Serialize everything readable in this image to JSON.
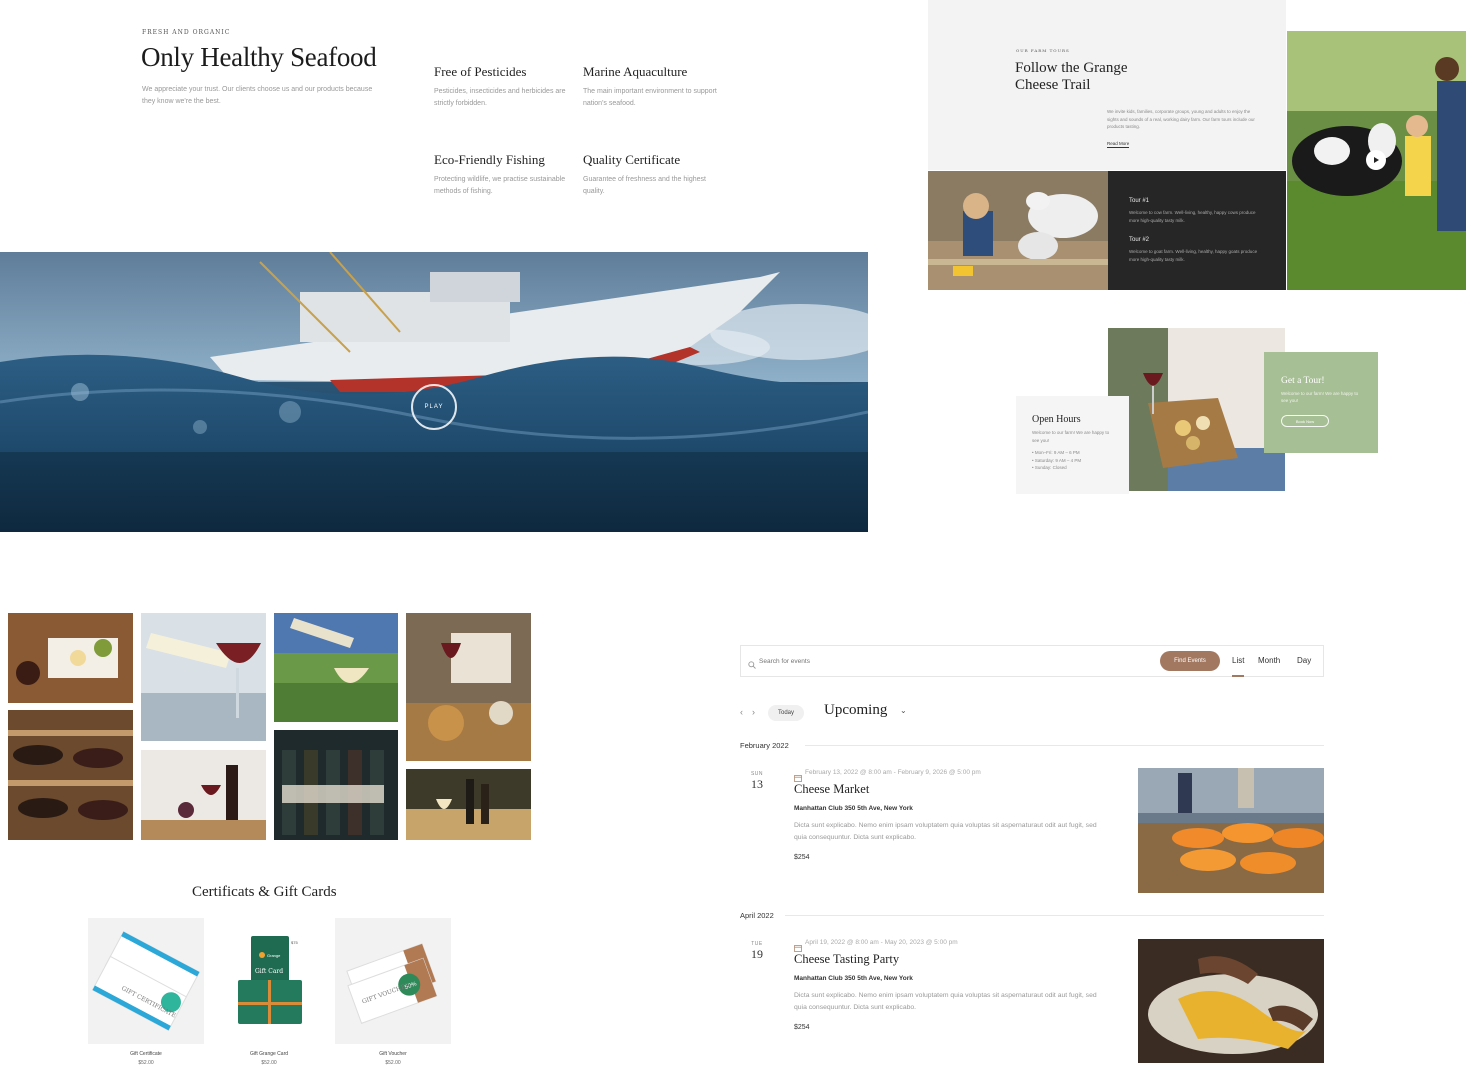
{
  "seafood": {
    "eyebrow": "FRESH AND ORGANIC",
    "title": "Only Healthy Seafood",
    "description": "We appreciate your trust. Our clients choose us and our products because they know we're the best.",
    "features": [
      {
        "title": "Free of Pesticides",
        "text": "Pesticides, insecticides and herbicides are strictly forbidden."
      },
      {
        "title": "Marine Aquaculture",
        "text": "The main important environment to support nation's seafood."
      },
      {
        "title": "Eco-Friendly Fishing",
        "text": "Protecting wildlife, we practise sustainable methods of fishing."
      },
      {
        "title": "Quality Certificate",
        "text": "Guarantee of freshness and the highest quality."
      }
    ],
    "play_label": "PLAY"
  },
  "farm_tours": {
    "eyebrow": "OUR FARM TOURS",
    "title_line1": "Follow the Grange",
    "title_line2": "Cheese Trail",
    "description": "We invite kids, families, corporate groups, young and adults to enjoy the sights and sounds of a real, working dairy farm. Our farm tours include our products tasting.",
    "read_more": "Read More",
    "tours": [
      {
        "name": "Tour #1",
        "text": "Welcome to cow farm. Well-living, healthy, happy cows produce more high-quality tasty milk."
      },
      {
        "name": "Tour #2",
        "text": "Welcome to goat farm. Well-living, healthy, happy goats produce more high-quality tasty milk."
      }
    ]
  },
  "open_hours": {
    "title": "Open Hours",
    "intro": "Welcome to our farm! We are happy to see you!",
    "items": [
      "Mon–Fri: 9 AM – 6 PM",
      "Saturday: 9 AM – 4 PM",
      "Sunday: Closed"
    ],
    "tour_card": {
      "title": "Get a Tour!",
      "text": "Welcome to our farm! We are happy to see you!",
      "button": "Book Now"
    }
  },
  "gift_cards": {
    "title": "Certificats & Gift Cards",
    "items": [
      {
        "name": "Gift Certificate",
        "price": "$52.00"
      },
      {
        "name": "Gift Grange Card",
        "price": "$52.00"
      },
      {
        "name": "Gift Voucher",
        "price": "$52.00"
      }
    ],
    "artwork_text": {
      "certificate": "GIFT CERTIFICATE",
      "card_brand": "Grange",
      "card_label": "Gift Card",
      "card_price": "$75",
      "voucher": "GIFT VOUCHER",
      "voucher_badge": "50%"
    }
  },
  "events": {
    "search_placeholder": "Search for events",
    "find_button": "Find Events",
    "views": [
      "List",
      "Month",
      "Day"
    ],
    "today_button": "Today",
    "heading": "Upcoming",
    "groups": [
      {
        "month": "February 2022",
        "event": {
          "dow": "SUN",
          "day": "13",
          "datetime": "February 13, 2022 @ 8:00 am - February 9, 2026 @ 5:00 pm",
          "title": "Cheese Market",
          "venue": "Manhattan Club 350 5th Ave, New York",
          "description": "Dicta sunt explicabo. Nemo enim ipsam voluptatem quia voluptas sit aspernaturaut odit aut fugit, sed quia consequuntur. Dicta sunt explicabo.",
          "price": "$254"
        }
      },
      {
        "month": "April 2022",
        "event": {
          "dow": "TUE",
          "day": "19",
          "datetime": "April 19, 2022 @ 8:00 am - May 20, 2023 @ 5:00 pm",
          "title": "Cheese Tasting Party",
          "venue": "Manhattan Club 350 5th Ave, New York",
          "description": "Dicta sunt explicabo. Nemo enim ipsam voluptatem quia voluptas sit aspernaturaut odit aut fugit, sed quia consequuntur. Dicta sunt explicabo.",
          "price": "$254"
        }
      }
    ]
  },
  "colors": {
    "accent_brown": "#a37860",
    "sage_green": "#a6bf94",
    "dark_panel": "#262626",
    "ocean_blue": "#234b6b"
  }
}
